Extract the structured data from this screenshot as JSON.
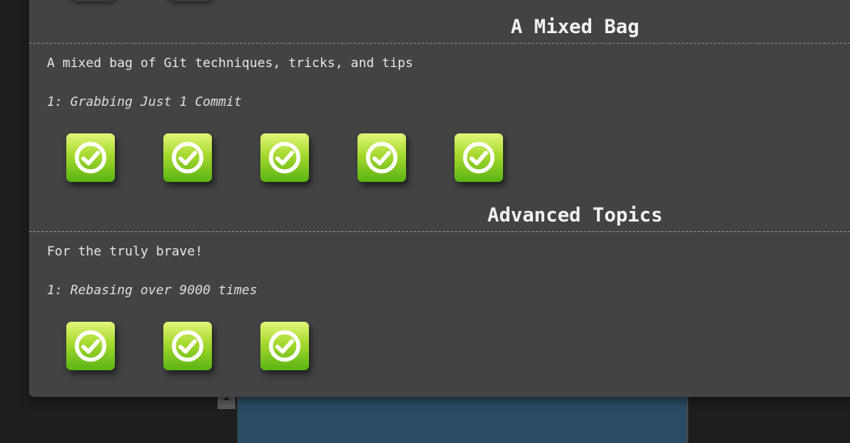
{
  "sections": [
    {
      "title": "A Mixed Bag",
      "description": "A mixed bag of Git techniques, tricks, and tips",
      "level": "1: Grabbing Just 1 Commit",
      "completed_count": 5
    },
    {
      "title": "Advanced Topics",
      "description": "For the truly brave!",
      "level": "1: Rebasing over 9000 times",
      "completed_count": 3
    }
  ],
  "icons": {
    "completed": "check-circle-icon"
  },
  "colors": {
    "panel": "#434343",
    "badge_top": "#e3f678",
    "badge_bottom": "#5ab414",
    "text": "#f2f2f2"
  }
}
